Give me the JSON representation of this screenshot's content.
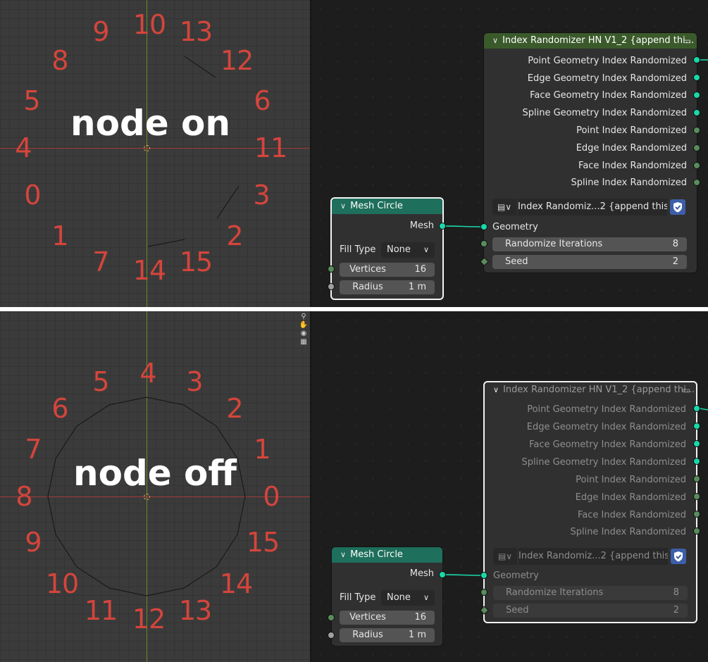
{
  "colors": {
    "label_red": "#d4453c",
    "geometry_socket": "#19d8a9",
    "integer_socket": "#598c5c",
    "float_socket": "#a1a1a1",
    "mesh_header": "#1e6f5b",
    "group_header": "#3b5a2b",
    "shield": "#3d5fa8"
  },
  "top": {
    "overlay_label": "node on",
    "index_labels": [
      "9",
      "10",
      "13",
      "12",
      "8",
      "5",
      "6",
      "4",
      "11",
      "0",
      "3",
      "1",
      "2",
      "7",
      "14",
      "15"
    ],
    "group_node": {
      "title": "Index Randomizer HN V1_2 {append thi...",
      "outputs": [
        "Point Geometry Index Randomized",
        "Edge Geometry Index Randomized",
        "Face Geometry Index Randomized",
        "Spline Geometry Index Randomized",
        "Point Index Randomized",
        "Edge Index Randomized",
        "Face Index Randomized",
        "Spline Index Randomized"
      ],
      "group_name": "Index Randomiz...2 {append this}",
      "geometry_input": "Geometry",
      "iterations_label": "Randomize Iterations",
      "iterations_value": "8",
      "seed_label": "Seed",
      "seed_value": "2"
    },
    "mesh_node": {
      "title": "Mesh Circle",
      "output": "Mesh",
      "fill_type_label": "Fill Type",
      "fill_type_value": "None",
      "vertices_label": "Vertices",
      "vertices_value": "16",
      "radius_label": "Radius",
      "radius_value": "1 m"
    }
  },
  "bottom": {
    "overlay_label": "node off",
    "index_labels": [
      "5",
      "4",
      "3",
      "6",
      "2",
      "7",
      "1",
      "8",
      "0",
      "9",
      "15",
      "10",
      "14",
      "11",
      "12",
      "13"
    ],
    "group_node": {
      "title": "Index Randomizer HN V1_2 {append thi...",
      "outputs": [
        "Point Geometry Index Randomized",
        "Edge Geometry Index Randomized",
        "Face Geometry Index Randomized",
        "Spline Geometry Index Randomized",
        "Point Index Randomized",
        "Edge Index Randomized",
        "Face Index Randomized",
        "Spline Index Randomized"
      ],
      "group_name": "Index Randomiz...2 {append this}",
      "geometry_input": "Geometry",
      "iterations_label": "Randomize Iterations",
      "iterations_value": "8",
      "seed_label": "Seed",
      "seed_value": "2"
    },
    "mesh_node": {
      "title": "Mesh Circle",
      "output": "Mesh",
      "fill_type_label": "Fill Type",
      "fill_type_value": "None",
      "vertices_label": "Vertices",
      "vertices_value": "16",
      "radius_label": "Radius",
      "radius_value": "1 m"
    }
  },
  "viewport_tools": [
    "zoom-icon",
    "hand-icon",
    "camera-icon",
    "grid-icon"
  ]
}
